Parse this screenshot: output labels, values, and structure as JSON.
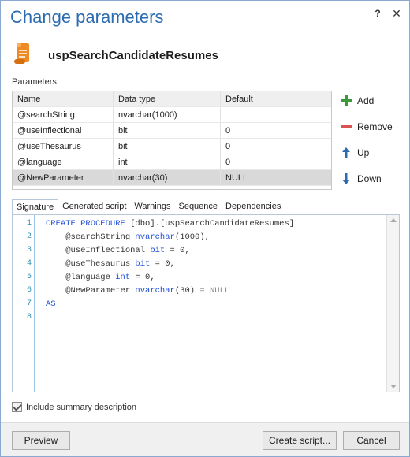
{
  "dialog": {
    "title": "Change parameters",
    "help_label": "?",
    "close_label": "✕"
  },
  "object": {
    "name": "uspSearchCandidateResumes"
  },
  "parameters": {
    "label": "Parameters:",
    "columns": [
      "Name",
      "Data type",
      "Default"
    ],
    "rows": [
      [
        "@searchString",
        "nvarchar(1000)",
        ""
      ],
      [
        "@useInflectional",
        "bit",
        "0"
      ],
      [
        "@useThesaurus",
        "bit",
        "0"
      ],
      [
        "@language",
        "int",
        "0"
      ],
      [
        "@NewParameter",
        "nvarchar(30)",
        "NULL"
      ]
    ],
    "selected_row": 4
  },
  "actions": {
    "add": "Add",
    "remove": "Remove",
    "up": "Up",
    "down": "Down"
  },
  "tabs": [
    "Signature",
    "Generated script",
    "Warnings",
    "Sequence",
    "Dependencies"
  ],
  "active_tab": "Signature",
  "editor": {
    "line_numbers": [
      "1",
      "2",
      "3",
      "4",
      "5",
      "6",
      "7",
      "8"
    ],
    "line1": {
      "kw": "CREATE PROCEDURE",
      "rest": " [dbo].[uspSearchCandidateResumes]"
    },
    "line2": {
      "name": "    @searchString ",
      "type": "nvarchar",
      "rest": "(1000),"
    },
    "line3": {
      "name": "    @useInflectional ",
      "type": "bit",
      "rest": " = 0,"
    },
    "line4": {
      "name": "    @useThesaurus ",
      "type": "bit",
      "rest": " = 0,"
    },
    "line5": {
      "name": "    @language ",
      "type": "int",
      "rest": " = 0,"
    },
    "line6": {
      "name": "    @NewParameter ",
      "type": "nvarchar",
      "rest": "(30) ",
      "eq": "=",
      "null": " NULL"
    },
    "line7": {
      "kw": "AS"
    }
  },
  "include_summary": {
    "label": "Include summary description",
    "checked": true
  },
  "footer": {
    "preview": "Preview",
    "create_script": "Create script...",
    "cancel": "Cancel"
  },
  "colors": {
    "title": "#2b6cb0",
    "keyword": "#1f4fd6",
    "add_icon": "#3a9a3a",
    "remove_icon": "#d9534f",
    "arrow_icon": "#2b6cb0",
    "selected_row": "#d9d9d9"
  },
  "icons": {
    "object": "stored-procedure-scroll-icon",
    "add": "plus-icon",
    "remove": "minus-icon",
    "up": "arrow-up-icon",
    "down": "arrow-down-icon"
  }
}
